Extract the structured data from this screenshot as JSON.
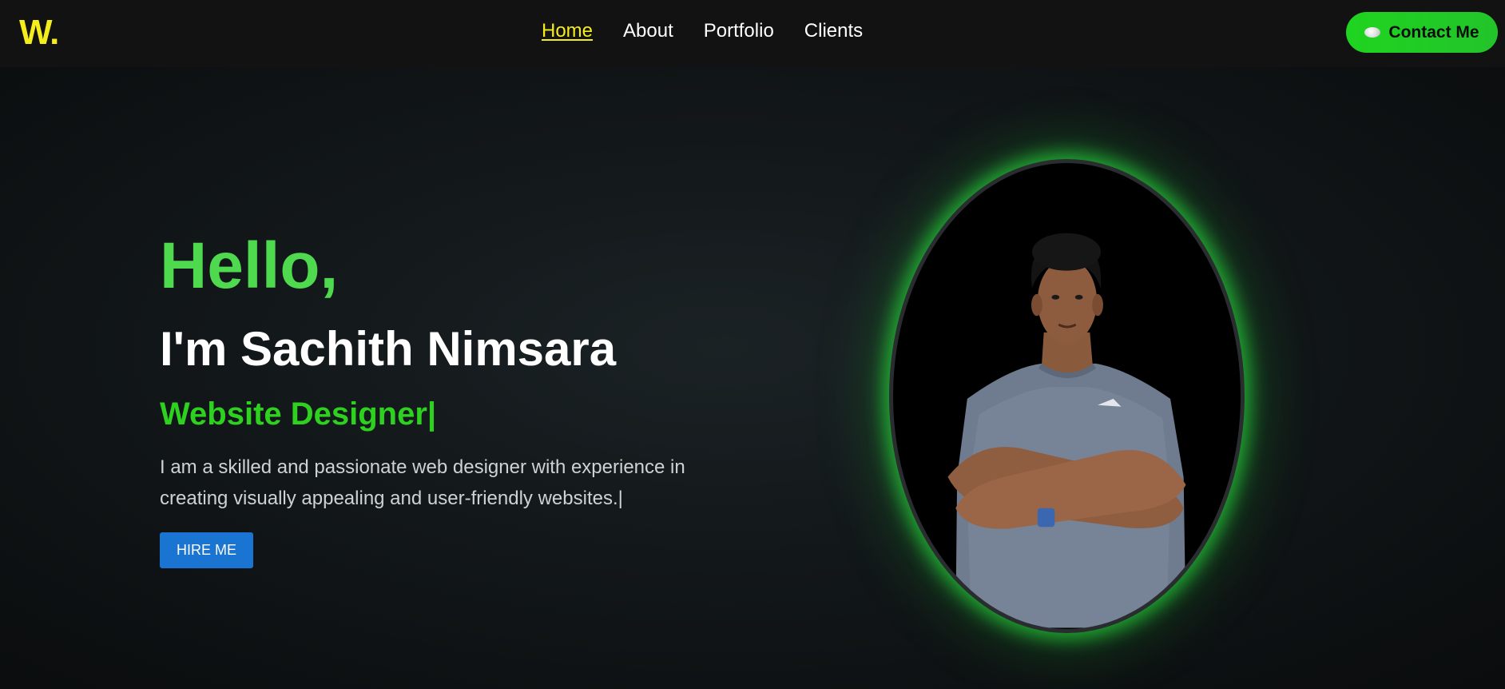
{
  "brand": {
    "logo": "W."
  },
  "nav": {
    "links": [
      {
        "label": "Home",
        "active": true
      },
      {
        "label": "About"
      },
      {
        "label": "Portfolio"
      },
      {
        "label": "Clients"
      }
    ],
    "contact_label": "Contact Me",
    "contact_icon": "chat-bubble-icon"
  },
  "hero": {
    "greeting": "Hello,",
    "name": "I'm Sachith Nimsara",
    "role": "Website Designer|",
    "description": "I am a skilled and passionate web designer with experience in creating visually appealing and user-friendly websites.|",
    "hire_label": "HIRE ME",
    "photo": "profile-photo"
  },
  "colors": {
    "accent_yellow": "#f5ec1c",
    "accent_green": "#2ed11f",
    "button_blue": "#1a74d2",
    "background": "#0b0d0e"
  }
}
